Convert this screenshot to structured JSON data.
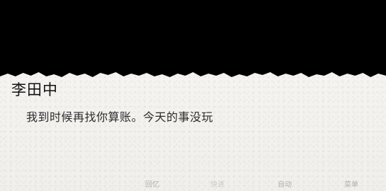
{
  "dialogue": {
    "speaker": "李田中",
    "text": "我到时候再找你算账。今天的事没玩"
  },
  "menu": {
    "review_label": "回忆",
    "skip_label": "快进",
    "auto_label": "自动",
    "menu_label": "菜单"
  }
}
